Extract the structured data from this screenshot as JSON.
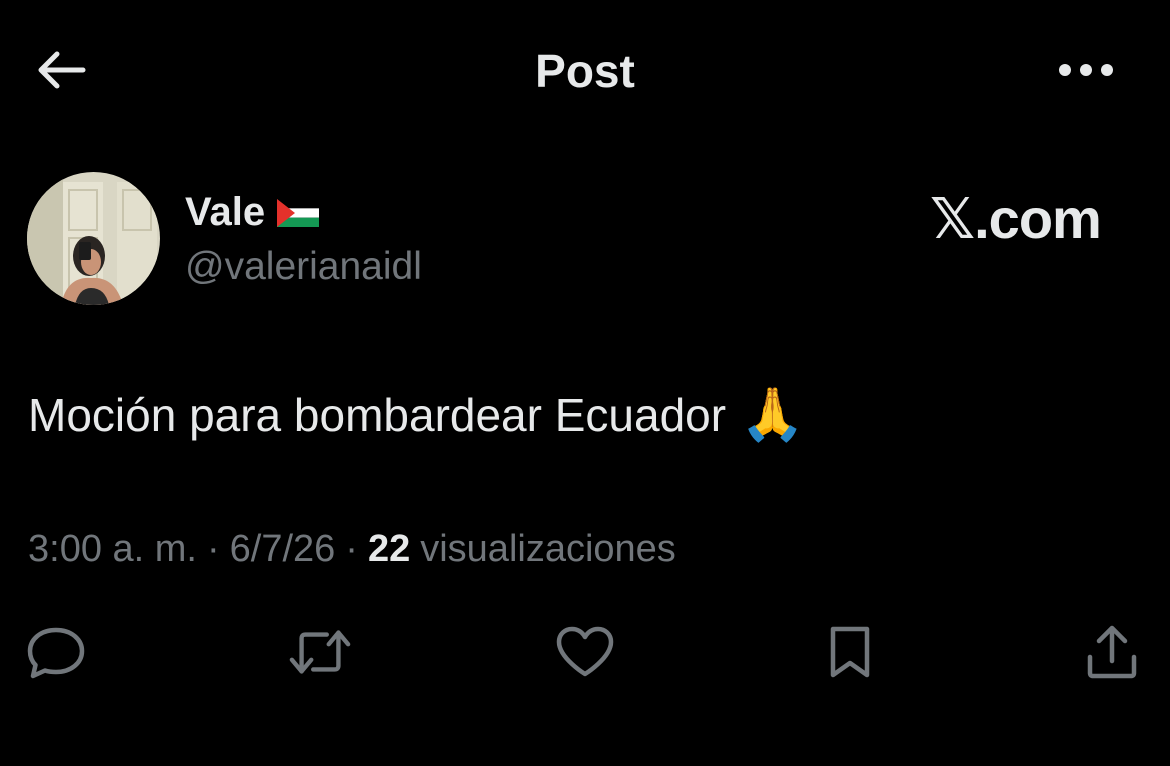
{
  "header": {
    "back_icon": "arrow-left-icon",
    "title": "Post",
    "more_icon": "more-horizontal-icon"
  },
  "author": {
    "display_name": "Vale",
    "flag_icon": "palestine-flag-icon",
    "handle": "@valerianaidl"
  },
  "watermark": {
    "prefix": "𝕏",
    "suffix": ".com"
  },
  "post": {
    "text": "Moción para bombardear Ecuador",
    "emoji": "🙏"
  },
  "meta": {
    "time": "3:00 a. m.",
    "sep1": "·",
    "date": "6/7/26",
    "sep2": "·",
    "view_count": "22",
    "view_label": "visualizaciones"
  },
  "actions": [
    {
      "icon": "reply-icon"
    },
    {
      "icon": "repost-icon"
    },
    {
      "icon": "like-icon"
    },
    {
      "icon": "bookmark-icon"
    },
    {
      "icon": "share-icon"
    }
  ],
  "colors": {
    "background": "#000000",
    "text_primary": "#e7e9ea",
    "text_secondary": "#71767b",
    "flag_black": "#000000",
    "flag_white": "#ffffff",
    "flag_green": "#149954",
    "flag_red": "#e4312b"
  }
}
